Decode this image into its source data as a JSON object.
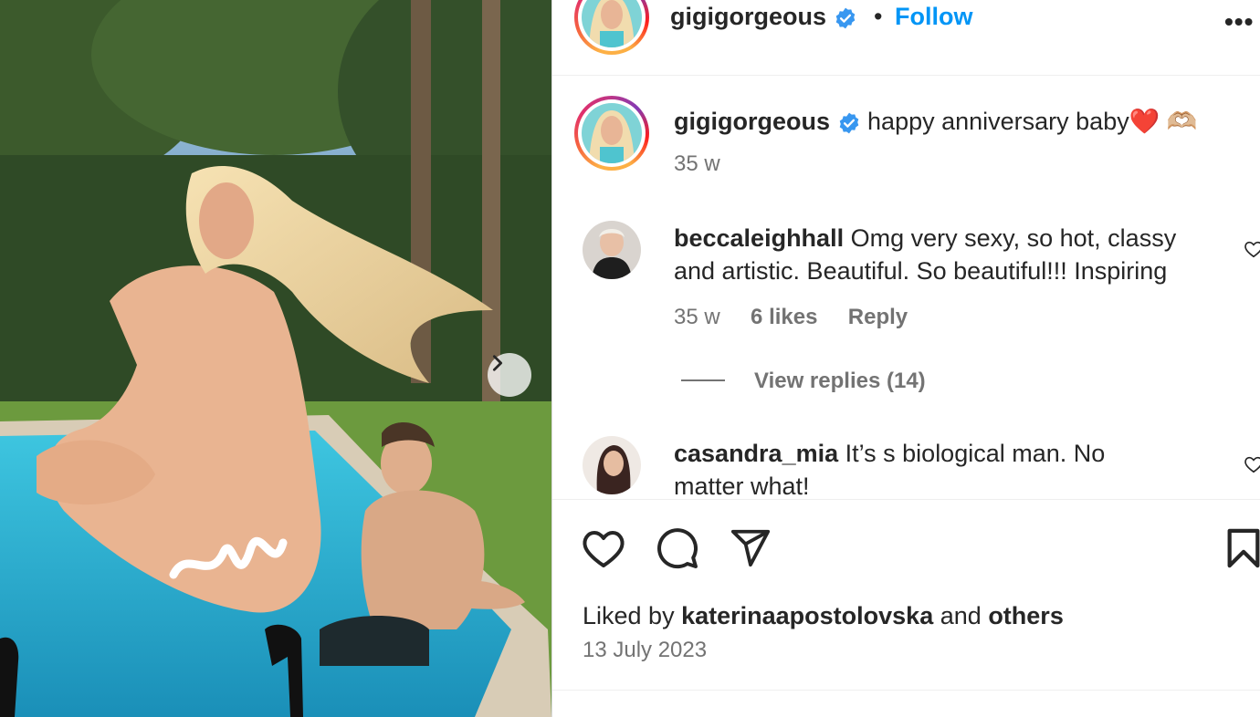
{
  "post": {
    "username": "gigigorgeous",
    "separator": "•",
    "follow_label": "Follow",
    "more_label": "•••",
    "caption_text": "happy anniversary baby",
    "caption_emoji_heart": "❤️",
    "caption_emoji_hands": "🫶🏼",
    "caption_time": "35 w",
    "liked_by_prefix": "Liked by",
    "liked_by_user": "katerinaapostolovska",
    "liked_by_and": "and",
    "liked_by_others": "others",
    "date": "13 July 2023"
  },
  "comments": [
    {
      "username": "beccaleighhall",
      "line1": "Omg very sexy, so hot, classy",
      "line2": "and artistic. Beautiful. So beautiful!!! Inspiring",
      "time": "35 w",
      "likes": "6 likes",
      "reply": "Reply",
      "view_replies": "View replies (14)"
    },
    {
      "username": "casandra_mia",
      "line1": "It’s s biological man. No",
      "line2": "matter what!"
    }
  ],
  "icons": {
    "verified": "verified-badge-icon",
    "next": "chevron-right-icon",
    "like": "heart-outline-icon",
    "comment": "comment-bubble-icon",
    "share": "paper-plane-icon",
    "save": "bookmark-icon"
  },
  "colors": {
    "follow_blue": "#0095f6",
    "verified_blue": "#3897f0",
    "muted_text": "#737373"
  }
}
